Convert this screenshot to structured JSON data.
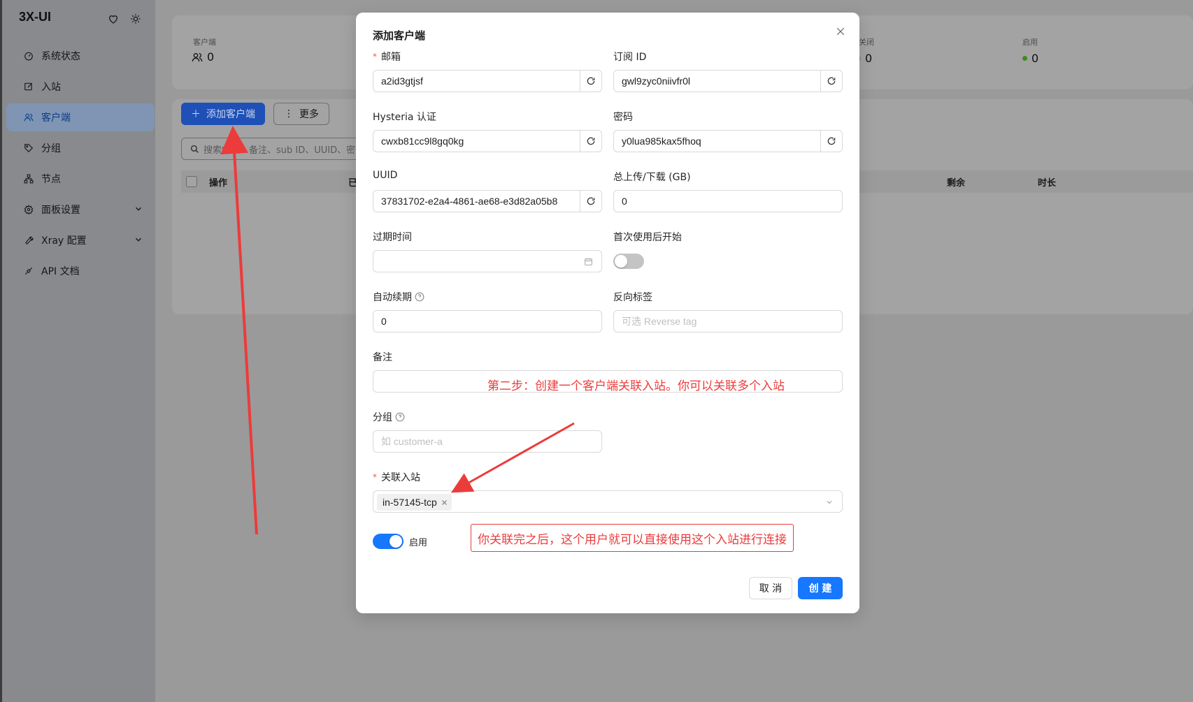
{
  "app": {
    "brand": "3X-UI"
  },
  "sidebar": {
    "items": [
      {
        "label": "系统状态",
        "icon": "dashboard-icon"
      },
      {
        "label": "入站",
        "icon": "edit-icon"
      },
      {
        "label": "客户端",
        "icon": "users-icon",
        "active": true
      },
      {
        "label": "分组",
        "icon": "tag-icon"
      },
      {
        "label": "节点",
        "icon": "cluster-icon"
      },
      {
        "label": "面板设置",
        "icon": "gear-icon",
        "expandable": true
      },
      {
        "label": "Xray 配置",
        "icon": "tool-icon",
        "expandable": true
      },
      {
        "label": "API 文档",
        "icon": "api-icon"
      }
    ]
  },
  "background": {
    "stats": {
      "clients_label": "客户端",
      "clients_value": "0",
      "closed_label": "关闭",
      "closed_value": "0",
      "enabled_label": "启用",
      "enabled_value": "0"
    },
    "toolbar": {
      "add_client": "添加客户端",
      "more": "更多"
    },
    "search_placeholder": "搜索邮箱、备注、sub ID、UUID、密",
    "table_headers": {
      "action": "操作",
      "col2": "已",
      "remaining": "剩余",
      "duration": "时长"
    }
  },
  "modal": {
    "title": "添加客户端",
    "fields": {
      "email": {
        "label": "邮箱",
        "value": "a2id3gtjsf",
        "required": true
      },
      "sub_id": {
        "label": "订阅 ID",
        "value": "gwl9zyc0niivfr0l"
      },
      "hysteria": {
        "label": "Hysteria 认证",
        "value": "cwxb81cc9l8gq0kg"
      },
      "password": {
        "label": "密码",
        "value": "y0lua985kax5fhoq"
      },
      "uuid": {
        "label": "UUID",
        "value": "37831702-e2a4-4861-ae68-e3d82a05b8"
      },
      "total_gb": {
        "label": "总上传/下载 (GB)",
        "value": "0"
      },
      "expiry": {
        "label": "过期时间",
        "value": ""
      },
      "start_after_first_use": {
        "label": "首次使用后开始",
        "on": false
      },
      "auto_renew": {
        "label": "自动续期",
        "value": "0"
      },
      "reverse_tag": {
        "label": "反向标签",
        "placeholder": "可选 Reverse tag"
      },
      "remark": {
        "label": "备注",
        "value": ""
      },
      "group": {
        "label": "分组",
        "placeholder": "如 customer-a"
      },
      "inbounds": {
        "label": "关联入站",
        "required": true,
        "selected": [
          "in-57145-tcp"
        ]
      },
      "enable": {
        "label": "启用",
        "on": true
      }
    },
    "buttons": {
      "cancel": "取 消",
      "create": "创 建"
    }
  },
  "annotations": {
    "step2": "第二步：创建一个客户端关联入站。你可以关联多个入站",
    "note": "你关联完之后，这个用户就可以直接使用这个入站进行连接"
  },
  "colors": {
    "primary": "#1677ff",
    "annotation": "#ec3b3b",
    "online": "#52c41a"
  }
}
